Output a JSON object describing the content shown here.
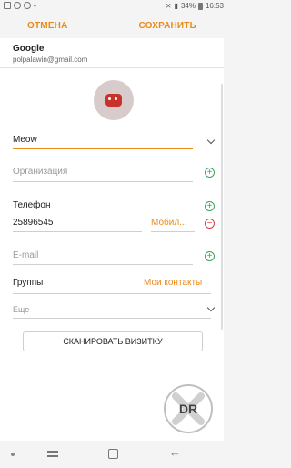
{
  "status": {
    "battery": "34%",
    "time": "16:53"
  },
  "header": {
    "cancel": "ОТМЕНА",
    "save": "СОХРАНИТЬ"
  },
  "account": {
    "name": "Google",
    "email": "polpalawin@gmail.com"
  },
  "form": {
    "name_value": "Meow",
    "organization_placeholder": "Организация",
    "phone_label": "Телефон",
    "phone_value": "25896545",
    "phone_type": "Мобил...",
    "email_placeholder": "E-mail",
    "groups_label": "Группы",
    "groups_value": "Мои контакты",
    "more": "Еще"
  },
  "scan_button": "СКАНИРОВАТЬ ВИЗИТКУ",
  "watermark": {
    "text": "DR"
  },
  "colors": {
    "accent": "#e88a1a",
    "add": "#3aa35a",
    "remove": "#d9403a"
  }
}
